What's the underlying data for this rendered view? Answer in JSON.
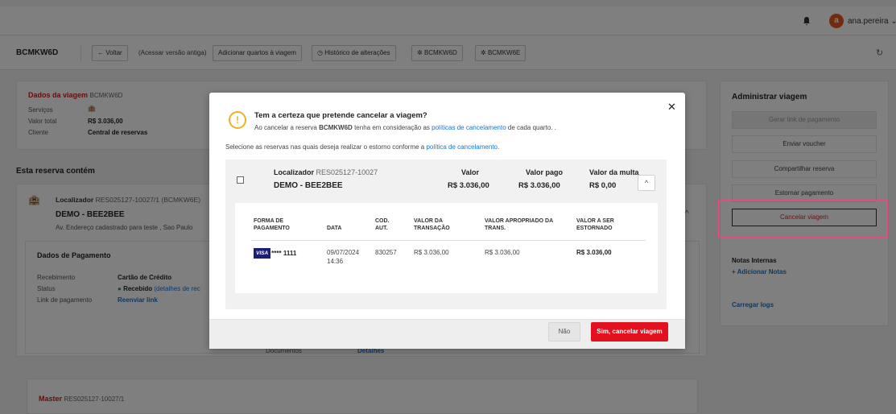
{
  "header": {
    "user": "ana.pereira",
    "avatar_initial": "a"
  },
  "toolbar": {
    "code": "BCMKW6D",
    "back": "← Voltar",
    "old_version": "(Acessar versão antiga)",
    "add_rooms": "Adicionar quartos à viagem",
    "history": "Histórico de alterações",
    "booking_1": "BCMKW6D",
    "booking_2": "BCMKW6E"
  },
  "trip": {
    "title": "Dados da viagem",
    "code": "BCMKW6D",
    "services_label": "Serviços",
    "total_label": "Valor total",
    "total_value": "R$ 3.036,00",
    "client_label": "Cliente",
    "client_value": "Central de reservas"
  },
  "reservation_block": {
    "heading": "Esta reserva contém",
    "locator_label": "Localizador",
    "locator_value": "RES025127-10027/1",
    "locator_code": "(BCMKW6E)",
    "hotel_name": "DEMO - BEE2BEE",
    "address": "Av. Endereço cadastrado para teste , Sao Paulo"
  },
  "payment": {
    "heading": "Dados de Pagamento",
    "received_label": "Recebimento",
    "received_value": "Cartão de Crédito",
    "status_label": "Status",
    "status_value": "Recebido",
    "status_link": "(detalhes de rec",
    "link_label": "Link de pagamento",
    "link_value": "Reenviar link",
    "docs_label": "Documentos",
    "docs_value": "Detalhes"
  },
  "master": {
    "label": "Master",
    "locator": "RES025127-10027/1"
  },
  "right_panel": {
    "title": "Administrar viagem",
    "buttons": [
      "Gerar link de pagamento",
      "Enviar voucher",
      "Compartilhar reserva",
      "Estornar pagamento",
      "Cancelar viagem"
    ],
    "notes_title": "Notas Internas",
    "notes_add": "+ Adicionar Notas",
    "logs": "Carregar logs"
  },
  "modal": {
    "title": "Tem a certeza que pretende cancelar a viagem?",
    "sub_prefix": "Ao cancelar a reserva",
    "sub_code": "BCMKW6D",
    "sub_middle": "tenha em consideração as",
    "sub_link": "políticas de cancelamento",
    "sub_suffix": "de cada quarto. .",
    "instr_prefix": "Selecione as reservas nas quais deseja realizar o estorno conforme a",
    "instr_link": "política de cancelamento",
    "instr_suffix": ".",
    "locator_label": "Localizador",
    "locator_value": "RES025127-10027",
    "hotel_name": "DEMO - BEE2BEE",
    "cols": [
      {
        "label": "Valor",
        "value": "R$ 3.036,00"
      },
      {
        "label": "Valor pago",
        "value": "R$ 3.036,00"
      },
      {
        "label": "Valor da multa",
        "value": "R$ 0,00"
      }
    ],
    "table": {
      "headers": [
        "FORMA DE PAGAMENTO",
        "DATA",
        "COD. AUT.",
        "VALOR DA TRANSAÇÃO",
        "VALOR APROPRIADO DA TRANS.",
        "VALOR A SER ESTORNADO"
      ],
      "row": {
        "card_brand": "VISA",
        "card_number": "**** 1111",
        "date": "09/07/2024",
        "time": "14:36",
        "auth": "830257",
        "transaction": "R$ 3.036,00",
        "appropriated": "R$ 3.036,00",
        "refund": "R$ 3.036,00"
      }
    },
    "btn_no": "Não",
    "btn_yes": "Sim, cancelar viagem"
  }
}
